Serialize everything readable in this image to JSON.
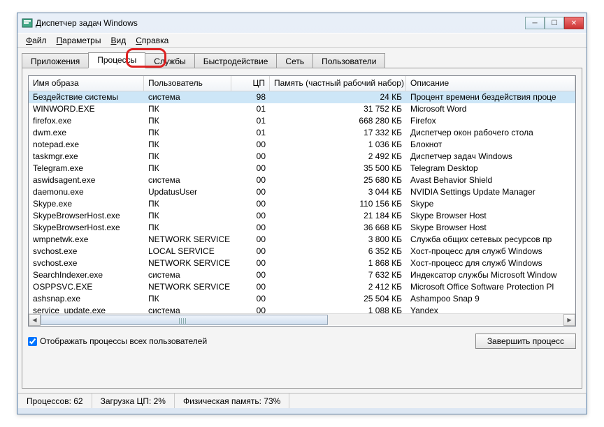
{
  "window": {
    "title": "Диспетчер задач Windows"
  },
  "menu": [
    "Файл",
    "Параметры",
    "Вид",
    "Справка"
  ],
  "tabs": [
    "Приложения",
    "Процессы",
    "Службы",
    "Быстродействие",
    "Сеть",
    "Пользователи"
  ],
  "active_tab_index": 1,
  "highlighted_tab_index": 2,
  "columns": {
    "image": "Имя образа",
    "user": "Пользователь",
    "cpu": "ЦП",
    "memory": "Память (частный рабочий набор)",
    "desc": "Описание"
  },
  "rows": [
    {
      "image": "Бездействие системы",
      "user": "система",
      "cpu": "98",
      "memory": "24 КБ",
      "desc": "Процент времени бездействия проце",
      "selected": true
    },
    {
      "image": "WINWORD.EXE",
      "user": "ПК",
      "cpu": "01",
      "memory": "31 752 КБ",
      "desc": "Microsoft Word"
    },
    {
      "image": "firefox.exe",
      "user": "ПК",
      "cpu": "01",
      "memory": "668 280 КБ",
      "desc": "Firefox"
    },
    {
      "image": "dwm.exe",
      "user": "ПК",
      "cpu": "01",
      "memory": "17 332 КБ",
      "desc": "Диспетчер окон рабочего стола"
    },
    {
      "image": "notepad.exe",
      "user": "ПК",
      "cpu": "00",
      "memory": "1 036 КБ",
      "desc": "Блокнот"
    },
    {
      "image": "taskmgr.exe",
      "user": "ПК",
      "cpu": "00",
      "memory": "2 492 КБ",
      "desc": "Диспетчер задач Windows"
    },
    {
      "image": "Telegram.exe",
      "user": "ПК",
      "cpu": "00",
      "memory": "35 500 КБ",
      "desc": "Telegram Desktop"
    },
    {
      "image": "aswidsagent.exe",
      "user": "система",
      "cpu": "00",
      "memory": "25 680 КБ",
      "desc": "Avast Behavior Shield"
    },
    {
      "image": "daemonu.exe",
      "user": "UpdatusUser",
      "cpu": "00",
      "memory": "3 044 КБ",
      "desc": "NVIDIA Settings Update Manager"
    },
    {
      "image": "Skype.exe",
      "user": "ПК",
      "cpu": "00",
      "memory": "110 156 КБ",
      "desc": "Skype"
    },
    {
      "image": "SkypeBrowserHost.exe",
      "user": "ПК",
      "cpu": "00",
      "memory": "21 184 КБ",
      "desc": "Skype Browser Host"
    },
    {
      "image": "SkypeBrowserHost.exe",
      "user": "ПК",
      "cpu": "00",
      "memory": "36 668 КБ",
      "desc": "Skype Browser Host"
    },
    {
      "image": "wmpnetwk.exe",
      "user": "NETWORK SERVICE",
      "cpu": "00",
      "memory": "3 800 КБ",
      "desc": "Служба общих сетевых ресурсов пр"
    },
    {
      "image": "svchost.exe",
      "user": "LOCAL SERVICE",
      "cpu": "00",
      "memory": "6 352 КБ",
      "desc": "Хост-процесс для служб Windows"
    },
    {
      "image": "svchost.exe",
      "user": "NETWORK SERVICE",
      "cpu": "00",
      "memory": "1 868 КБ",
      "desc": "Хост-процесс для служб Windows"
    },
    {
      "image": "SearchIndexer.exe",
      "user": "система",
      "cpu": "00",
      "memory": "7 632 КБ",
      "desc": "Индексатор службы Microsoft Window"
    },
    {
      "image": "OSPPSVC.EXE",
      "user": "NETWORK SERVICE",
      "cpu": "00",
      "memory": "2 412 КБ",
      "desc": "Microsoft Office Software Protection Pl"
    },
    {
      "image": "ashsnap.exe",
      "user": "ПК",
      "cpu": "00",
      "memory": "25 504 КБ",
      "desc": "Ashampoo Snap 9"
    },
    {
      "image": "service_update.exe",
      "user": "система",
      "cpu": "00",
      "memory": "1 088 КБ",
      "desc": "Yandex"
    }
  ],
  "checkbox": {
    "label": "Отображать процессы всех пользователей",
    "checked": true
  },
  "end_process_button": "Завершить процесс",
  "status": {
    "processes": "Процессов: 62",
    "cpu": "Загрузка ЦП: 2%",
    "mem": "Физическая память: 73%"
  }
}
